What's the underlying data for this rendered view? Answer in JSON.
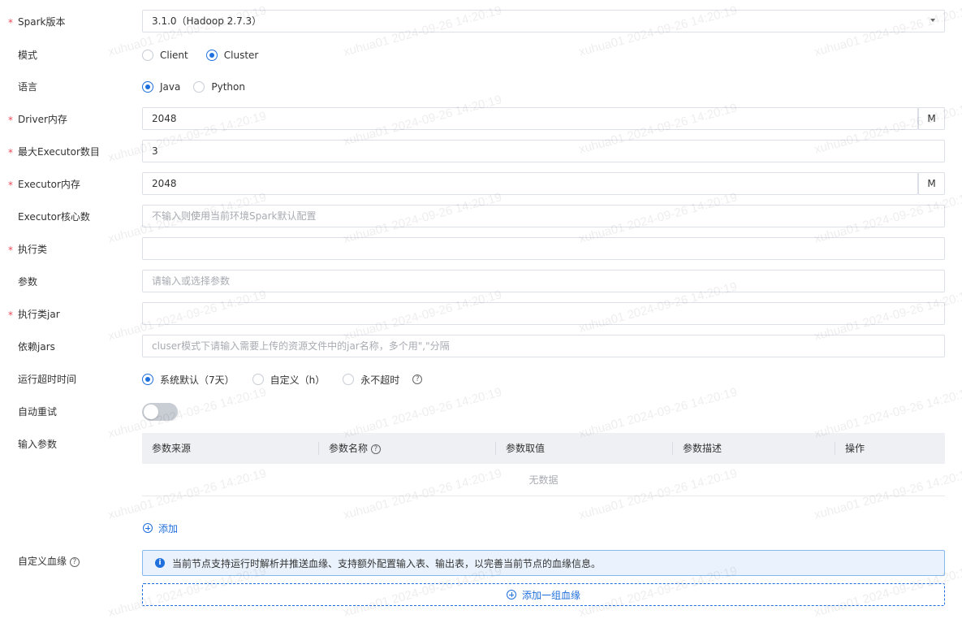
{
  "form": {
    "spark_version": {
      "label": "Spark版本",
      "required": true,
      "value": "3.1.0（Hadoop 2.7.3）"
    },
    "mode": {
      "label": "模式",
      "options": [
        "Client",
        "Cluster"
      ],
      "selected": "Cluster"
    },
    "language": {
      "label": "语言",
      "options": [
        "Java",
        "Python"
      ],
      "selected": "Java"
    },
    "driver_memory": {
      "label": "Driver内存",
      "required": true,
      "value": "2048",
      "unit": "M"
    },
    "max_executors": {
      "label": "最大Executor数目",
      "required": true,
      "value": "3"
    },
    "executor_memory": {
      "label": "Executor内存",
      "required": true,
      "value": "2048",
      "unit": "M"
    },
    "executor_cores": {
      "label": "Executor核心数",
      "placeholder": "不输入则使用当前环境Spark默认配置"
    },
    "main_class": {
      "label": "执行类",
      "required": true,
      "value": ""
    },
    "params": {
      "label": "参数",
      "placeholder": "请输入或选择参数"
    },
    "main_jar": {
      "label": "执行类jar",
      "required": true,
      "value": ""
    },
    "dep_jars": {
      "label": "依赖jars",
      "placeholder": "cluser模式下请输入需要上传的资源文件中的jar名称，多个用\",\"分隔"
    },
    "timeout": {
      "label": "运行超时时间",
      "options": [
        "系统默认（7天）",
        "自定义（h）",
        "永不超时"
      ],
      "selected": "系统默认（7天）"
    },
    "auto_retry": {
      "label": "自动重试",
      "enabled": false
    },
    "input_params": {
      "label": "输入参数",
      "columns": [
        "参数来源",
        "参数名称",
        "参数取值",
        "参数描述",
        "操作"
      ],
      "empty_text": "无数据",
      "add_label": "添加"
    },
    "lineage": {
      "label": "自定义血缘",
      "info": "当前节点支持运行时解析并推送血缘、支持额外配置输入表、输出表，以完善当前节点的血缘信息。",
      "add_label": "添加一组血缘"
    }
  },
  "watermark": "xuhua01 2024-09-26 14:20:19",
  "colors": {
    "primary": "#1f6fdc",
    "required": "#e34d59",
    "info_bg": "#eaf3fd"
  }
}
